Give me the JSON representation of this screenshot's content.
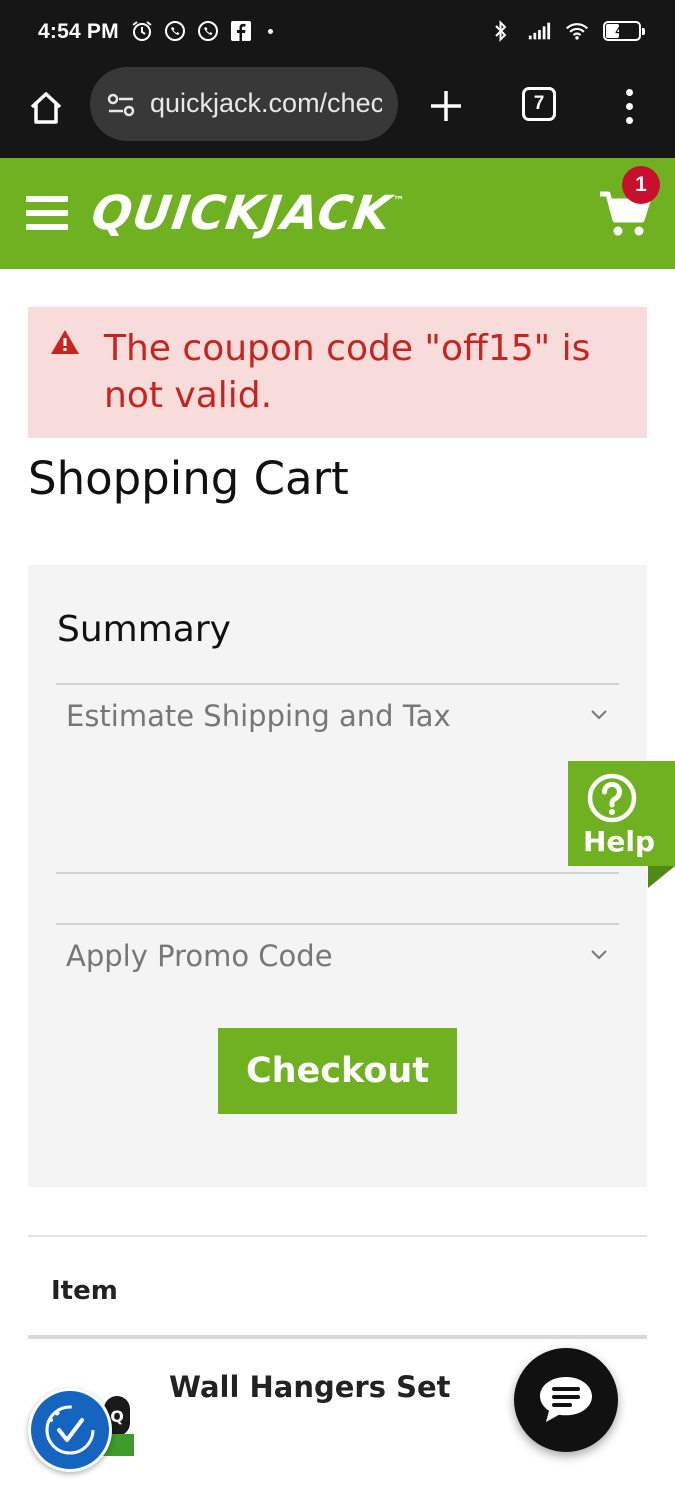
{
  "status_bar": {
    "time": "4:54 PM",
    "battery_level": "41",
    "icons_left": [
      "alarm-icon",
      "whatsapp-icon",
      "whatsapp-icon",
      "facebook-icon",
      "dot-icon"
    ],
    "icons_right": [
      "bluetooth-icon",
      "signal-icon",
      "wifi-icon",
      "battery-icon"
    ]
  },
  "browser": {
    "url": "quickjack.com/checkout/cart/",
    "tab_count": "7",
    "icons": [
      "home-icon",
      "site-settings-icon",
      "new-tab-icon",
      "tabs-icon",
      "more-menu-icon"
    ]
  },
  "header": {
    "logo_text": "QUICKJACK",
    "logo_tm": "™",
    "cart_count": "1",
    "brand_color": "#6fb121",
    "icons": [
      "hamburger-icon",
      "cart-icon"
    ]
  },
  "alert": {
    "message": "The coupon code \"off15\" is not valid.",
    "color": "#c5241f",
    "background": "#f7dcdb",
    "icon": "warning-icon"
  },
  "page": {
    "title": "Shopping Cart"
  },
  "summary": {
    "title": "Summary",
    "shipping_label": "Estimate Shipping and Tax",
    "promo_label": "Apply Promo Code",
    "checkout_label": "Checkout"
  },
  "help_widget": {
    "label": "Help",
    "icon": "question-icon"
  },
  "table": {
    "column_header": "Item",
    "items": [
      {
        "name": "Wall Hangers Set"
      }
    ]
  },
  "floating": {
    "accessibility_icon": "accessibility-check-icon",
    "chat_icon": "chat-bubble-icon"
  }
}
